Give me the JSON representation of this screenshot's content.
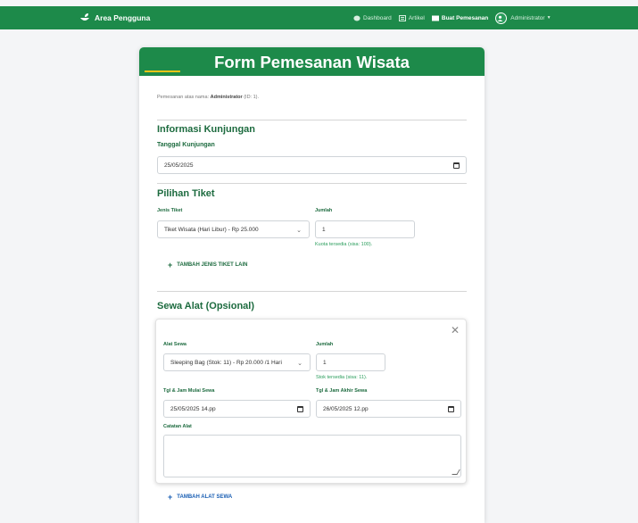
{
  "navbar": {
    "brand": "Area Pengguna",
    "links": [
      {
        "label": "Dashboard",
        "icon": "palette-icon"
      },
      {
        "label": "Artikel",
        "icon": "newspaper-icon"
      },
      {
        "label": "Buat Pemesanan",
        "icon": "ticket-icon",
        "active": true
      }
    ],
    "user": "Administrator",
    "color": "#1d8a4a"
  },
  "form": {
    "title": "Form Pemesanan Wisata",
    "owner_prefix": "Pemesanan atas nama:",
    "owner_name": "Administrator",
    "owner_suffix": "(ID: 1).",
    "visit": {
      "section_title": "Informasi Kunjungan",
      "date_label": "Tanggal Kunjungan",
      "date_value": "25/05/2025"
    },
    "tickets": {
      "section_title": "Pilihan Tiket",
      "type_label": "Jenis Tiket",
      "type_value": "Tiket Wisata (Hari Libur) - Rp 25.000",
      "qty_label": "Jumlah",
      "qty_value": "1",
      "quota_hint": "Kuota tersedia (sisa: 100).",
      "add_label": "TAMBAH JENIS TIKET LAIN"
    },
    "rental": {
      "section_title": "Sewa Alat (Opsional)",
      "item_label": "Alat Sewa",
      "item_value": "Sleeping Bag (Stok: 11) - Rp 20.000 /1 Hari",
      "qty_label": "Jumlah",
      "qty_value": "1",
      "stock_hint": "Stok tersedia (sisa: 11).",
      "start_label": "Tgl & Jam Mulai Sewa",
      "start_value": "25/05/2025 14.pp",
      "end_label": "Tgl & Jam Akhir Sewa",
      "end_value": "26/05/2025 12.pp",
      "note_label": "Catatan Alat",
      "note_value": "",
      "add_label": "TAMBAH ALAT SEWA"
    }
  }
}
